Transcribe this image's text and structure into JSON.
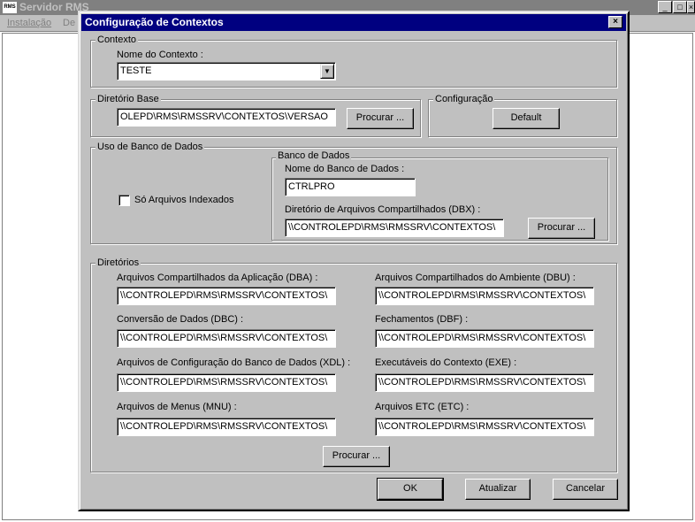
{
  "main_window": {
    "app_icon": "RMS",
    "title": "Servidor RMS",
    "menu": [
      "Instalação",
      "De"
    ],
    "controls": [
      "_",
      "□",
      "×"
    ]
  },
  "dialog": {
    "title": "Configuração de Contextos",
    "close_glyph": "×",
    "contexto": {
      "group_label": "Contexto",
      "name_label": "Nome do Contexto :",
      "name_value": "TESTE",
      "arrow": "▼"
    },
    "diretorio_base": {
      "group_label": "Diretório Base",
      "value": "OLEPD\\RMS\\RMSSRV\\CONTEXTOS\\VERSAO",
      "browse": "Procurar ..."
    },
    "configuracao": {
      "group_label": "Configuração",
      "default_button": "Default"
    },
    "uso_banco": {
      "group_label": "Uso de Banco de Dados",
      "checkbox_label": "Só Arquivos Indexados",
      "banco": {
        "group_label": "Banco de Dados",
        "db_name_label": "Nome do Banco de Dados :",
        "db_name_value": "CTRLPRO",
        "dbx_label": "Diretório de Arquivos Compartilhados (DBX) :",
        "dbx_value": "\\\\CONTROLEPD\\RMS\\RMSSRV\\CONTEXTOS\\",
        "browse": "Procurar ..."
      }
    },
    "diretorios": {
      "group_label": "Diretórios",
      "fields": [
        {
          "label": "Arquivos Compartilhados da Aplicação (DBA) :",
          "value": "\\\\CONTROLEPD\\RMS\\RMSSRV\\CONTEXTOS\\"
        },
        {
          "label": "Arquivos Compartilhados do Ambiente (DBU) :",
          "value": "\\\\CONTROLEPD\\RMS\\RMSSRV\\CONTEXTOS\\"
        },
        {
          "label": "Conversão de Dados (DBC) :",
          "value": "\\\\CONTROLEPD\\RMS\\RMSSRV\\CONTEXTOS\\"
        },
        {
          "label": "Fechamentos (DBF) :",
          "value": "\\\\CONTROLEPD\\RMS\\RMSSRV\\CONTEXTOS\\"
        },
        {
          "label": "Arquivos de Configuração do Banco de Dados (XDL) :",
          "value": "\\\\CONTROLEPD\\RMS\\RMSSRV\\CONTEXTOS\\"
        },
        {
          "label": "Executáveis do Contexto (EXE) :",
          "value": "\\\\CONTROLEPD\\RMS\\RMSSRV\\CONTEXTOS\\"
        },
        {
          "label": "Arquivos de Menus (MNU) :",
          "value": "\\\\CONTROLEPD\\RMS\\RMSSRV\\CONTEXTOS\\"
        },
        {
          "label": "Arquivos ETC (ETC) :",
          "value": "\\\\CONTROLEPD\\RMS\\RMSSRV\\CONTEXTOS\\"
        }
      ],
      "browse": "Procurar ..."
    },
    "buttons": {
      "ok": "OK",
      "update": "Atualizar",
      "cancel": "Cancelar"
    }
  }
}
